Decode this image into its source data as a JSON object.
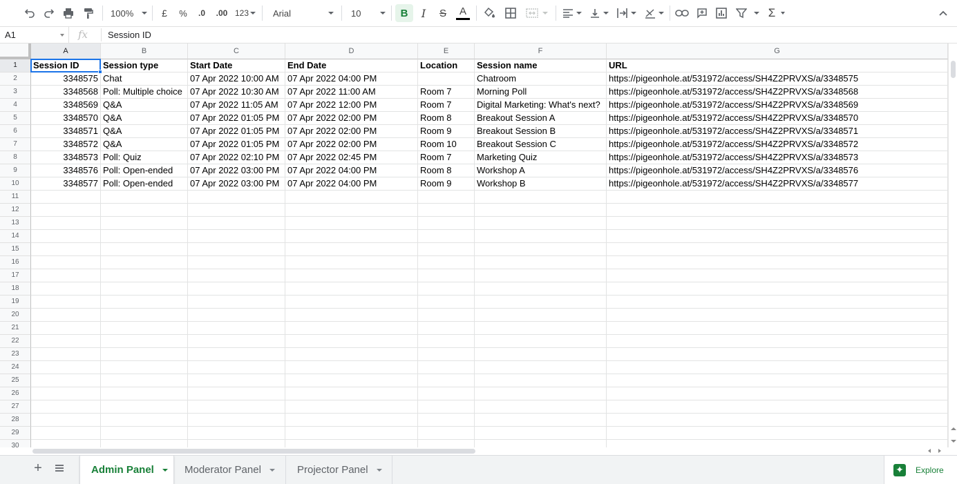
{
  "toolbar": {
    "zoom": "100%",
    "currency": "£",
    "percent": "%",
    "decrease_decimals": ".0",
    "increase_decimals": ".00",
    "more_formats": "123",
    "font": "Arial",
    "font_size": "10",
    "bold": "B",
    "italic": "I",
    "strikethrough": "S",
    "text_color": "A",
    "function": "Σ"
  },
  "formula_bar": {
    "name_box": "A1",
    "fx_label": "fx",
    "formula": "Session ID"
  },
  "grid": {
    "columns": [
      "A",
      "B",
      "C",
      "D",
      "E",
      "F",
      "G"
    ],
    "row_numbers": [
      "1",
      "2",
      "3",
      "4",
      "5",
      "6",
      "7",
      "8",
      "9",
      "10",
      "11",
      "12",
      "13",
      "14",
      "15",
      "16",
      "17",
      "18",
      "19",
      "20",
      "21",
      "22",
      "23",
      "24",
      "25",
      "26",
      "27",
      "28",
      "29",
      "30"
    ],
    "header_row": [
      "Session ID",
      "Session type",
      "Start Date",
      "End Date",
      "Location",
      "Session name",
      "URL"
    ],
    "rows": [
      [
        "3348575",
        "Chat",
        "07 Apr 2022 10:00 AM",
        "07 Apr 2022 04:00 PM",
        "",
        "Chatroom",
        "https://pigeonhole.at/531972/access/SH4Z2PRVXS/a/3348575"
      ],
      [
        "3348568",
        "Poll: Multiple choice",
        "07 Apr 2022 10:30 AM",
        "07 Apr 2022 11:00 AM",
        "Room 7",
        "Morning Poll",
        "https://pigeonhole.at/531972/access/SH4Z2PRVXS/a/3348568"
      ],
      [
        "3348569",
        "Q&A",
        "07 Apr 2022 11:05 AM",
        "07 Apr 2022 12:00 PM",
        "Room 7",
        "Digital Marketing: What's next?",
        "https://pigeonhole.at/531972/access/SH4Z2PRVXS/a/3348569"
      ],
      [
        "3348570",
        "Q&A",
        "07 Apr 2022 01:05 PM",
        "07 Apr 2022 02:00 PM",
        "Room 8",
        "Breakout Session A",
        "https://pigeonhole.at/531972/access/SH4Z2PRVXS/a/3348570"
      ],
      [
        "3348571",
        "Q&A",
        "07 Apr 2022 01:05 PM",
        "07 Apr 2022 02:00 PM",
        "Room 9",
        "Breakout Session B",
        "https://pigeonhole.at/531972/access/SH4Z2PRVXS/a/3348571"
      ],
      [
        "3348572",
        "Q&A",
        "07 Apr 2022 01:05 PM",
        "07 Apr 2022 02:00 PM",
        "Room 10",
        "Breakout Session C",
        "https://pigeonhole.at/531972/access/SH4Z2PRVXS/a/3348572"
      ],
      [
        "3348573",
        "Poll: Quiz",
        "07 Apr 2022 02:10 PM",
        "07 Apr 2022 02:45 PM",
        "Room 7",
        "Marketing Quiz",
        "https://pigeonhole.at/531972/access/SH4Z2PRVXS/a/3348573"
      ],
      [
        "3348576",
        "Poll: Open-ended",
        "07 Apr 2022 03:00 PM",
        "07 Apr 2022 04:00 PM",
        "Room 8",
        "Workshop A",
        "https://pigeonhole.at/531972/access/SH4Z2PRVXS/a/3348576"
      ],
      [
        "3348577",
        "Poll: Open-ended",
        "07 Apr 2022 03:00 PM",
        "07 Apr 2022 04:00 PM",
        "Room 9",
        "Workshop B",
        "https://pigeonhole.at/531972/access/SH4Z2PRVXS/a/3348577"
      ]
    ]
  },
  "sheet_tabs": {
    "tabs": [
      "Admin Panel",
      "Moderator Panel",
      "Projector Panel"
    ],
    "active": "Admin Panel",
    "explore_label": "Explore"
  },
  "colors": {
    "accent_green": "#188038",
    "selection_blue": "#1a73e8"
  }
}
